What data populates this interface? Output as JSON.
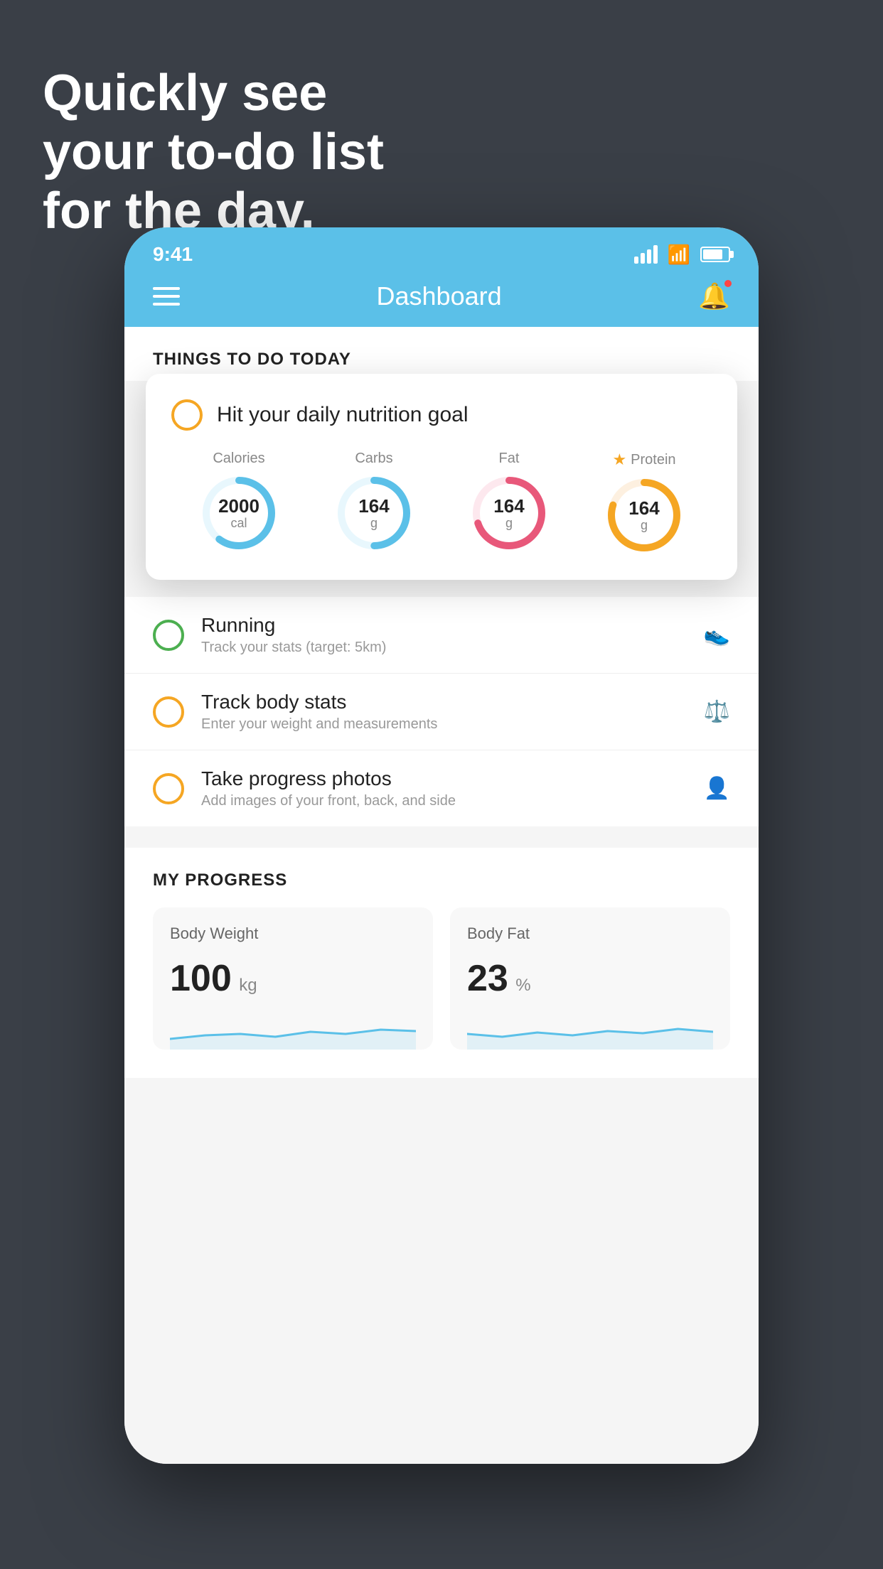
{
  "headline": {
    "line1": "Quickly see",
    "line2": "your to-do list",
    "line3": "for the day."
  },
  "statusBar": {
    "time": "9:41"
  },
  "navBar": {
    "title": "Dashboard"
  },
  "thingsToDo": {
    "sectionTitle": "THINGS TO DO TODAY",
    "featuredCard": {
      "title": "Hit your daily nutrition goal",
      "nutrients": [
        {
          "label": "Calories",
          "value": "2000",
          "unit": "cal",
          "color": "#5bc0e8",
          "percent": 60
        },
        {
          "label": "Carbs",
          "value": "164",
          "unit": "g",
          "color": "#5bc0e8",
          "percent": 50
        },
        {
          "label": "Fat",
          "value": "164",
          "unit": "g",
          "color": "#e8587a",
          "percent": 70
        },
        {
          "label": "Protein",
          "value": "164",
          "unit": "g",
          "color": "#f5a623",
          "percent": 80,
          "starred": true
        }
      ]
    },
    "items": [
      {
        "name": "Running",
        "desc": "Track your stats (target: 5km)",
        "icon": "👟",
        "checkColor": "green"
      },
      {
        "name": "Track body stats",
        "desc": "Enter your weight and measurements",
        "icon": "⚖️",
        "checkColor": "yellow"
      },
      {
        "name": "Take progress photos",
        "desc": "Add images of your front, back, and side",
        "icon": "👤",
        "checkColor": "yellow"
      }
    ]
  },
  "myProgress": {
    "sectionTitle": "MY PROGRESS",
    "cards": [
      {
        "label": "Body Weight",
        "value": "100",
        "unit": "kg"
      },
      {
        "label": "Body Fat",
        "value": "23",
        "unit": "%"
      }
    ]
  }
}
